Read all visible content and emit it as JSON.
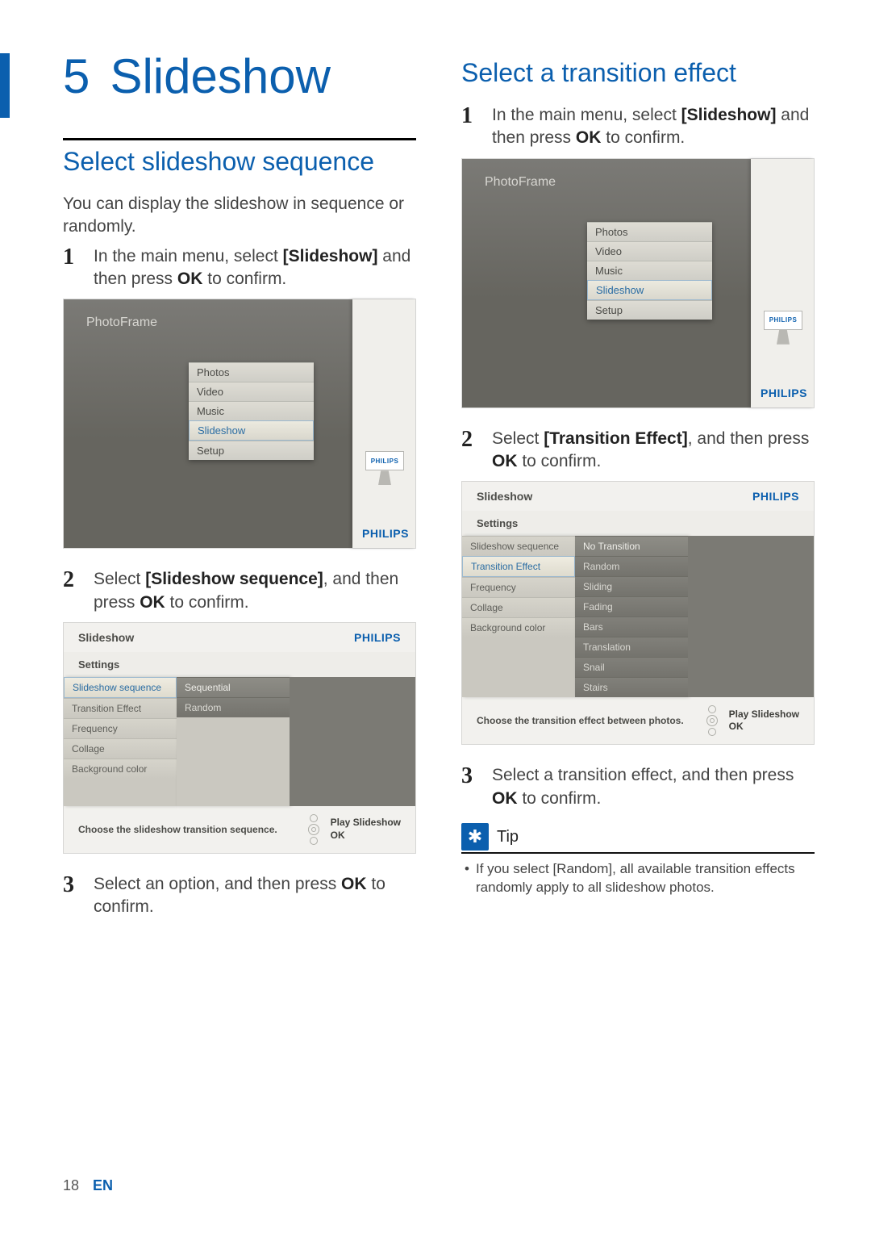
{
  "page": {
    "number": "18",
    "lang": "EN"
  },
  "chapter": {
    "num": "5",
    "title": "Slideshow"
  },
  "left": {
    "h2": "Select slideshow sequence",
    "intro_a": "You can display the slideshow in sequence or randomly.",
    "steps": [
      {
        "n": "1",
        "pre": "In the main menu, select ",
        "bold": "[Slideshow]",
        "mid": " and then press ",
        "bold2": "OK",
        "post": " to confirm."
      },
      {
        "n": "2",
        "pre": "Select ",
        "bold": "[Slideshow sequence]",
        "mid": ", and then press ",
        "bold2": "OK",
        "post": " to confirm."
      },
      {
        "n": "3",
        "pre": "Select an option, and then press ",
        "bold": "OK",
        "mid": " to confirm.",
        "bold2": "",
        "post": ""
      }
    ],
    "menu": {
      "title": "PhotoFrame",
      "items": [
        "Photos",
        "Video",
        "Music",
        "Slideshow",
        "Setup"
      ],
      "selected": "Slideshow",
      "brand": "PHILIPS"
    },
    "settings": {
      "header": "Slideshow",
      "brand": "PHILIPS",
      "sub": "Settings",
      "left_items": [
        "Slideshow sequence",
        "Transition Effect",
        "Frequency",
        "Collage",
        "Background color"
      ],
      "left_selected": "Slideshow sequence",
      "mid_items": [
        "Sequential",
        "Random"
      ],
      "hint": "Choose the slideshow transition sequence.",
      "btn_top": "Play Slideshow",
      "btn_mid": "OK"
    }
  },
  "right": {
    "h2": "Select a transition effect",
    "steps": [
      {
        "n": "1",
        "pre": "In the main menu, select ",
        "bold": "[Slideshow]",
        "mid": " and then press ",
        "bold2": "OK",
        "post": " to confirm."
      },
      {
        "n": "2",
        "pre": "Select ",
        "bold": "[Transition Effect]",
        "mid": ", and then press ",
        "bold2": "OK",
        "post": " to confirm."
      },
      {
        "n": "3",
        "pre": "Select a transition effect, and then press ",
        "bold": "OK",
        "mid": " to confirm.",
        "bold2": "",
        "post": ""
      }
    ],
    "menu": {
      "title": "PhotoFrame",
      "items": [
        "Photos",
        "Video",
        "Music",
        "Slideshow",
        "Setup"
      ],
      "selected": "Slideshow",
      "brand": "PHILIPS"
    },
    "settings": {
      "header": "Slideshow",
      "brand": "PHILIPS",
      "sub": "Settings",
      "left_items": [
        "Slideshow sequence",
        "Transition Effect",
        "Frequency",
        "Collage",
        "Background color"
      ],
      "left_selected": "Transition Effect",
      "mid_items": [
        "No Transition",
        "Random",
        "Sliding",
        "Fading",
        "Bars",
        "Translation",
        "Snail",
        "Stairs"
      ],
      "hint": "Choose the transition effect between photos.",
      "btn_top": "Play Slideshow",
      "btn_mid": "OK"
    },
    "tip": {
      "label": "Tip",
      "text_a": "If you select ",
      "text_bold": "[Random]",
      "text_b": ", all available transition effects randomly apply to all slideshow photos."
    }
  }
}
